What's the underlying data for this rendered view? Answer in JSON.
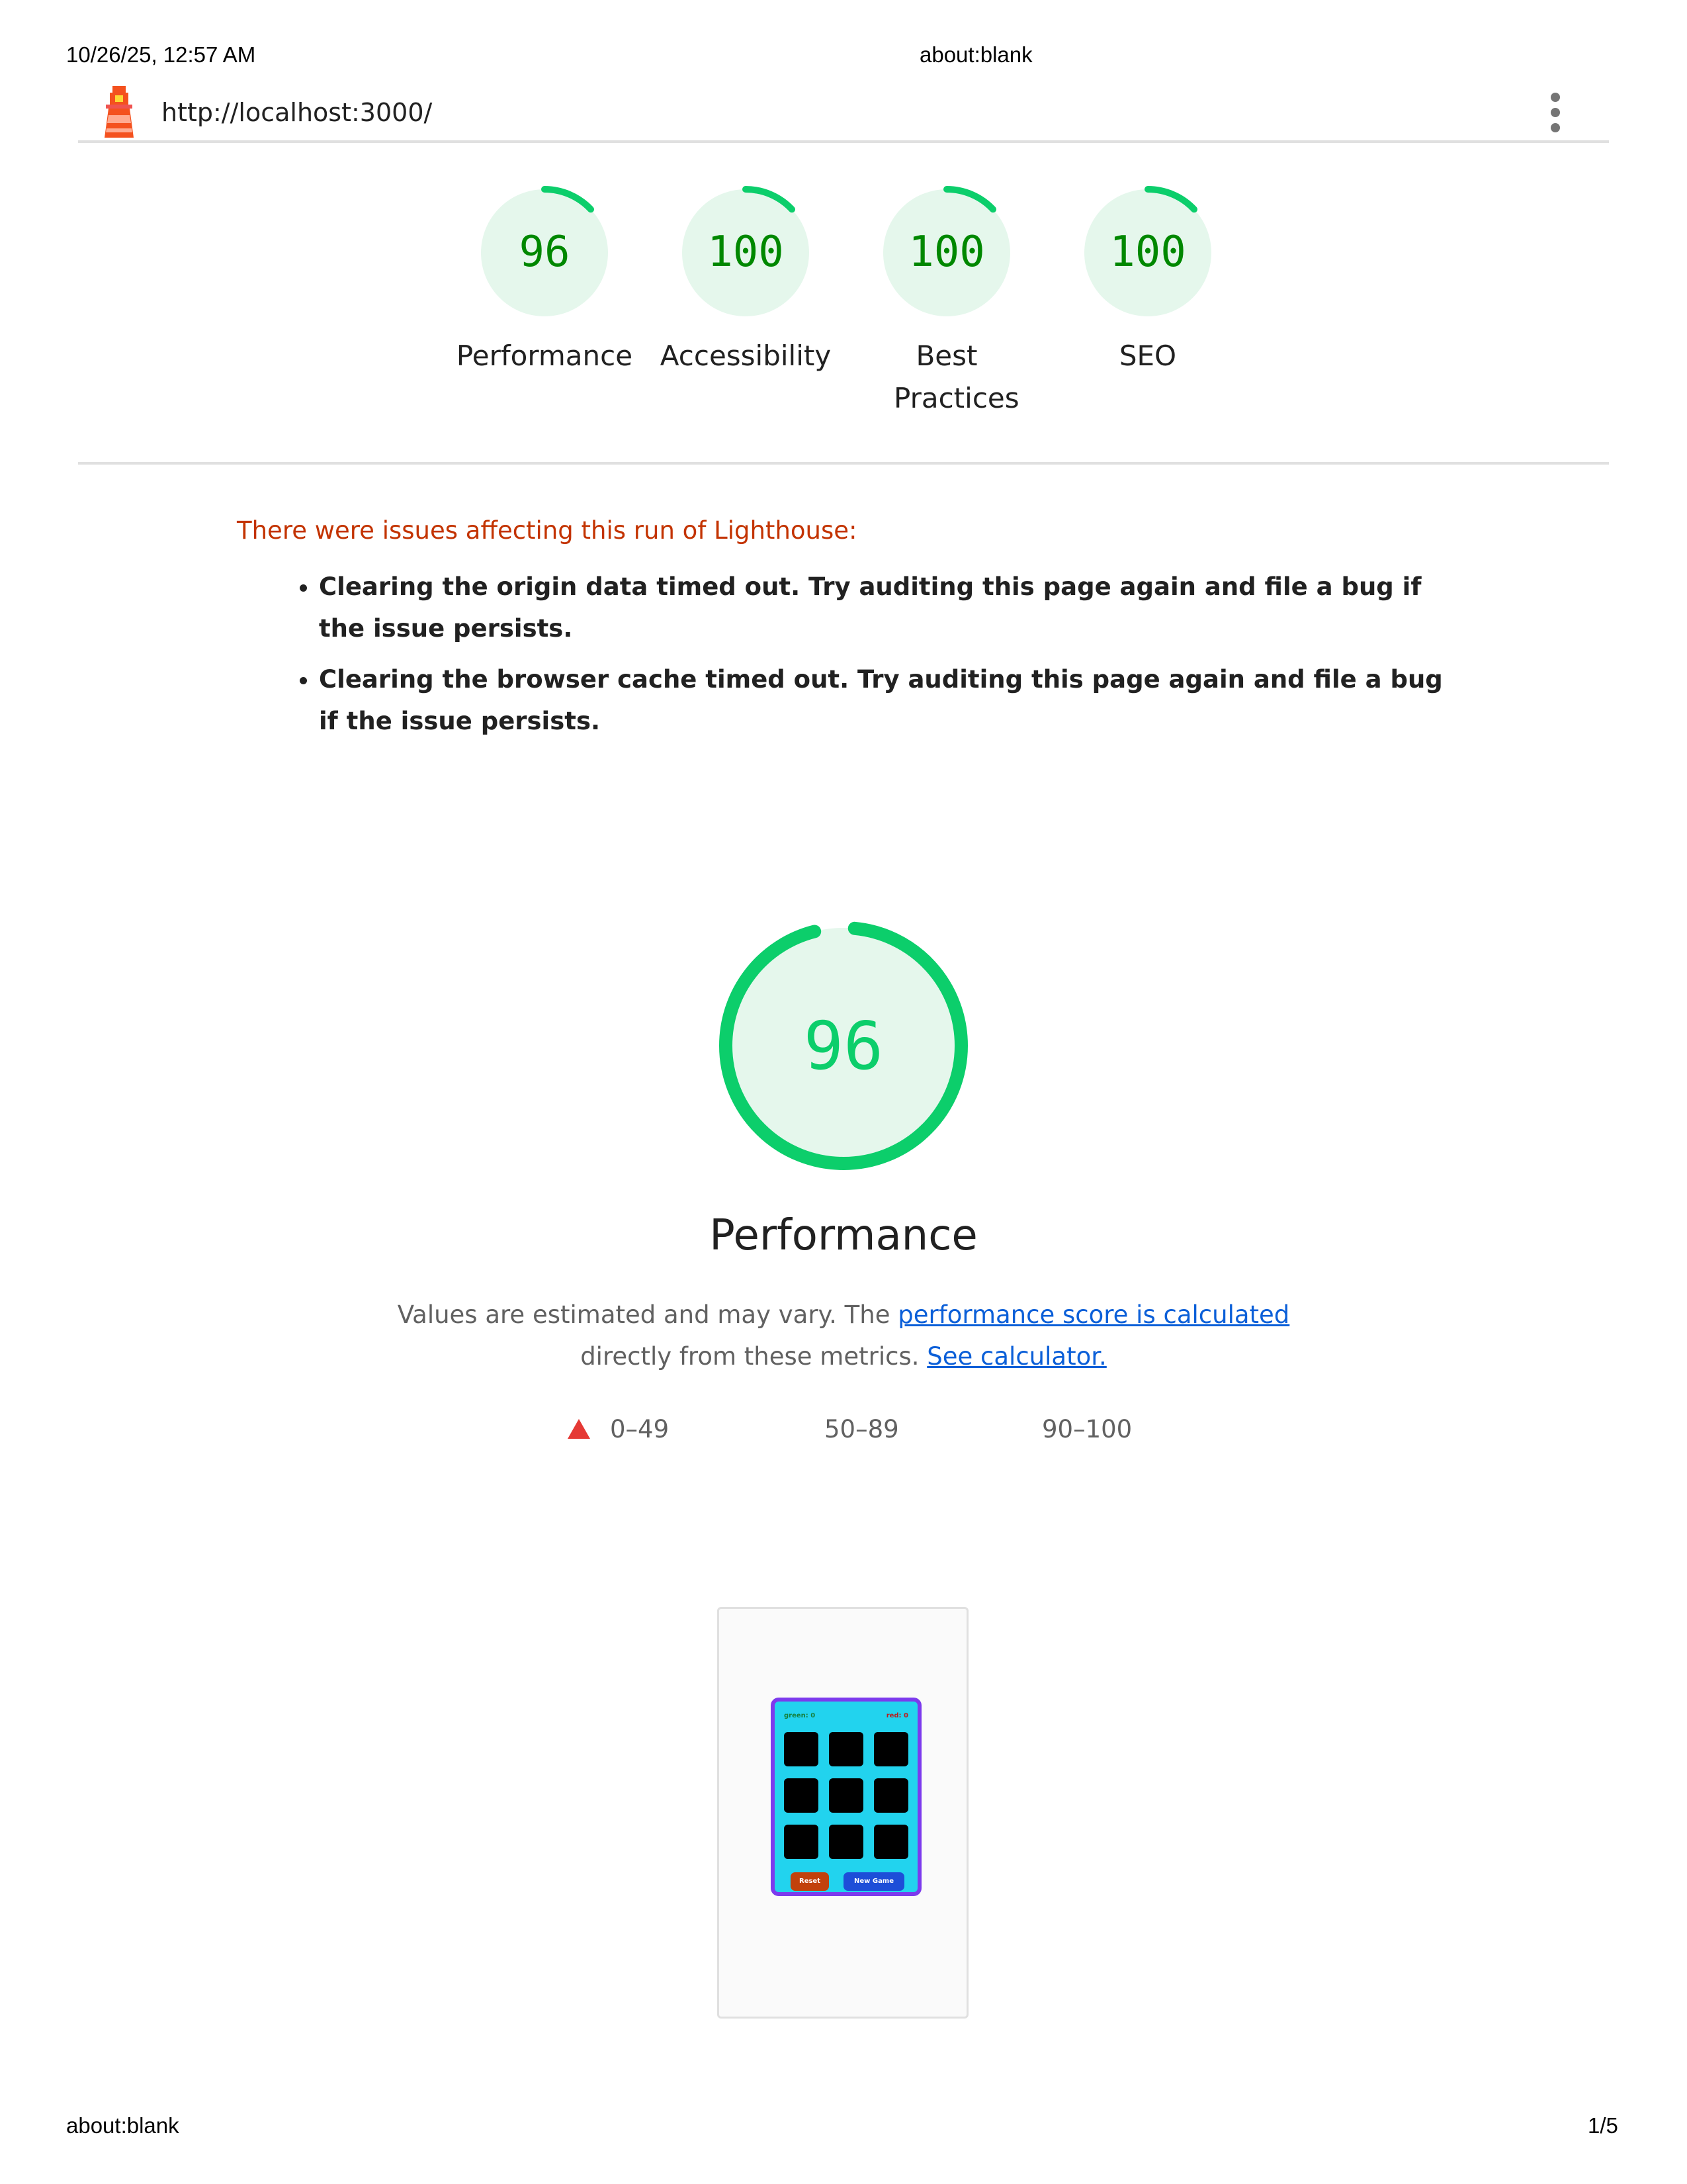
{
  "print_header": {
    "datetime": "10/26/25, 12:57 AM",
    "title": "about:blank"
  },
  "topbar": {
    "url": "http://localhost:3000/",
    "logo_icon": "lighthouse-icon",
    "menu_icon": "kebab-menu-icon"
  },
  "score_gauges": [
    {
      "score": "96",
      "label": "Performance",
      "value": 0.96
    },
    {
      "score": "100",
      "label": "Accessibility",
      "value": 1.0
    },
    {
      "score": "100",
      "label": "Best Practices",
      "value": 1.0
    },
    {
      "score": "100",
      "label": "SEO",
      "value": 1.0
    }
  ],
  "warnings": {
    "title": "There were issues affecting this run of Lighthouse:",
    "items": [
      "Clearing the origin data timed out. Try auditing this page again and file a bug if the issue persists.",
      "Clearing the browser cache timed out. Try auditing this page again and file a bug if the issue persists."
    ]
  },
  "performance": {
    "score": "96",
    "value": 0.96,
    "title": "Performance",
    "desc_prefix": "Values are estimated and may vary. The",
    "desc_link": "performance score is calculated",
    "desc_middle": "directly from these metrics.",
    "desc_calc_link": "See calculator."
  },
  "legend": [
    {
      "range": "0–49",
      "icon": "red-triangle-icon",
      "color": "#e53935"
    },
    {
      "range": "50–89",
      "icon": "orange-square-icon",
      "color": "#ffa400"
    },
    {
      "range": "90–100",
      "icon": "green-circle-icon",
      "color": "#0cce6b"
    }
  ],
  "screenshot": {
    "score_left": "green: 0",
    "score_right": "red: 0",
    "reset_label": "Reset",
    "new_game_label": "New Game"
  },
  "print_footer": {
    "left": "about:blank",
    "right": "1/5"
  },
  "colors": {
    "pass_green": "#0cce6b",
    "pass_text": "#008800",
    "pass_bg": "#e5f7ec",
    "warn_red": "#c33300",
    "link_blue": "#0b5fd8"
  }
}
